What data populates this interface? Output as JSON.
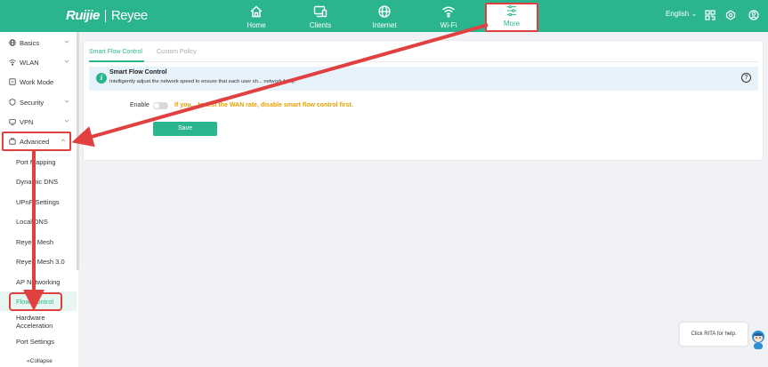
{
  "header": {
    "logo_brand": "Ruijie",
    "logo_sub": "Reyee",
    "nav": [
      {
        "label": "Home",
        "icon": "home-icon"
      },
      {
        "label": "Clients",
        "icon": "clients-icon"
      },
      {
        "label": "Internet",
        "icon": "globe-icon"
      },
      {
        "label": "Wi-Fi",
        "icon": "wifi-icon"
      },
      {
        "label": "More",
        "icon": "more-icon"
      }
    ],
    "language": "English"
  },
  "sidebar": {
    "items": [
      {
        "label": "Basics"
      },
      {
        "label": "WLAN"
      },
      {
        "label": "Work Mode"
      },
      {
        "label": "Security"
      },
      {
        "label": "VPN"
      },
      {
        "label": "Advanced"
      }
    ],
    "sub_items": [
      {
        "label": "Port Mapping"
      },
      {
        "label": "Dynamic DNS"
      },
      {
        "label": "UPnP Settings"
      },
      {
        "label": "Local DNS"
      },
      {
        "label": "Reyee Mesh"
      },
      {
        "label": "Reyee Mesh 3.0"
      },
      {
        "label": "AP Networking"
      },
      {
        "label": "Flow Control"
      },
      {
        "label": "Hardware Acceleration"
      },
      {
        "label": "Port Settings"
      }
    ],
    "collapse_label": "Collapse"
  },
  "main": {
    "tabs": [
      {
        "label": "Smart Flow Control"
      },
      {
        "label": "Custom Policy"
      }
    ],
    "info": {
      "title": "Smart Flow Control",
      "description": "Intelligently adjust the network speed to ensure that each user sh... network fairly."
    },
    "enable_label": "Enable",
    "enable_on": false,
    "warning": "If you... to test the WAN rate, disable smart flow control first.",
    "save_label": "Save"
  },
  "rita": {
    "tip": "Click RITA for help."
  },
  "colors": {
    "accent": "#2bb58e",
    "warning": "#e5a000",
    "annotation": "#e04040"
  }
}
